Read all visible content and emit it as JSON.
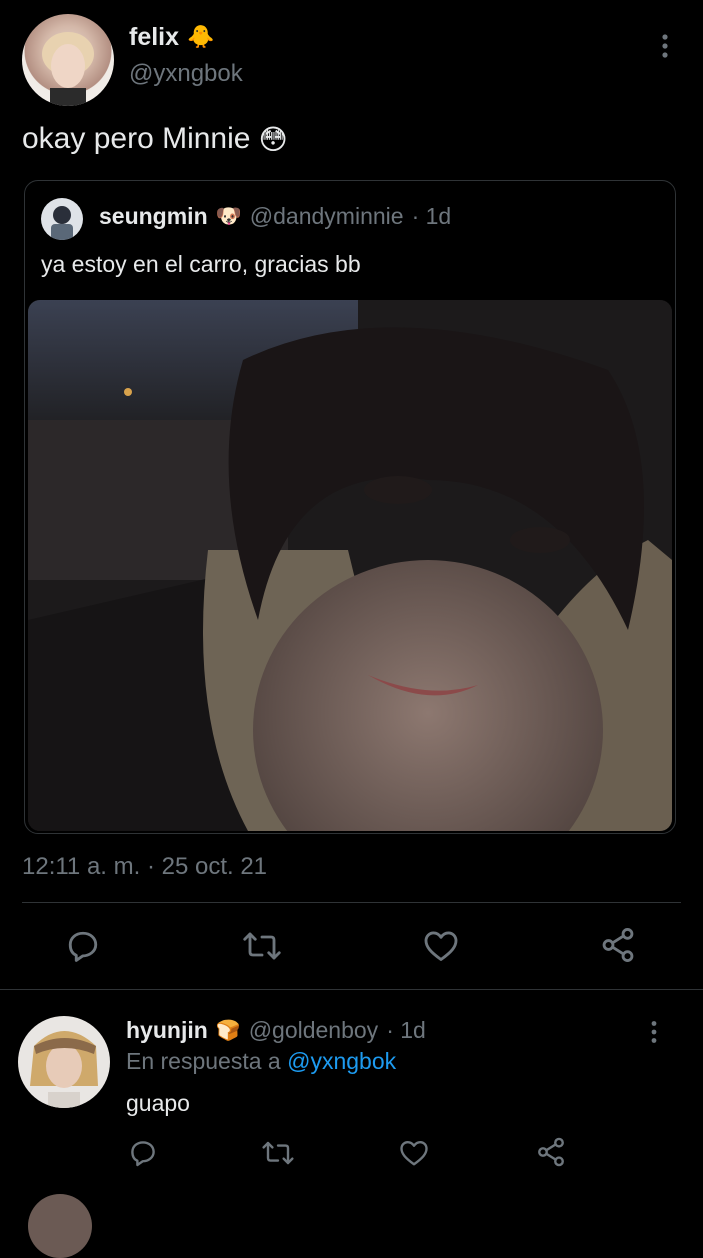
{
  "main_tweet": {
    "display_name": "felix",
    "name_emoji": "🐥",
    "handle": "@yxngbok",
    "text": "okay pero Minnie",
    "text_emoji": "😳",
    "timestamp": "12:11 a. m. · 25 oct. 21"
  },
  "quoted_tweet": {
    "display_name": "seungmin",
    "name_emoji": "🐶",
    "handle": "@dandyminnie",
    "age": "· 1d",
    "text": "ya estoy en el carro, gracias bb"
  },
  "reply": {
    "display_name": "hyunjin",
    "name_emoji": "🍞",
    "handle": "@goldenboy",
    "age": "· 1d",
    "reply_prefix": "En respuesta a",
    "reply_to": "@yxngbok",
    "text": "guapo"
  },
  "actions": [
    "reply-icon",
    "retweet-icon",
    "like-icon",
    "share-icon"
  ],
  "colors": {
    "background": "#000000",
    "text": "#e7e9ea",
    "muted": "#6e767d",
    "link": "#1d9bf0",
    "border": "#2f3336"
  }
}
